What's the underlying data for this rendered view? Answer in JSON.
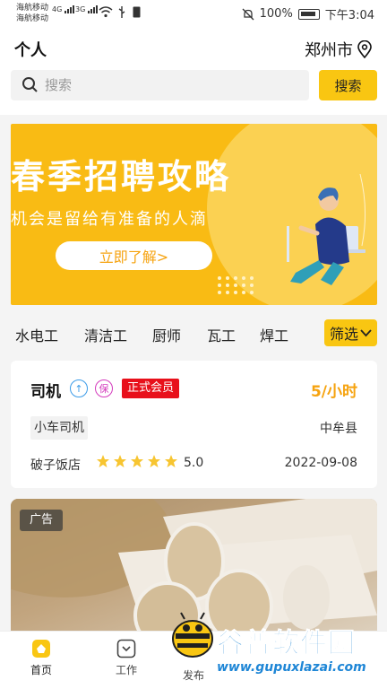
{
  "status_bar": {
    "carrier_1": "海航移动",
    "carrier_2": "海航移动",
    "net_1": "4G",
    "net_2": "3G",
    "battery": "100%",
    "time": "下午3:04"
  },
  "header": {
    "title": "个人",
    "city": "郑州市"
  },
  "search": {
    "placeholder": "搜索",
    "button": "搜索"
  },
  "banner": {
    "title": "春季招聘攻略",
    "subtitle": "机会是留给有准备的人滴",
    "button": "立即了解>"
  },
  "categories": {
    "items": [
      "水电工",
      "清洁工",
      "厨师",
      "瓦工",
      "焊工"
    ],
    "filter": "筛选"
  },
  "job": {
    "title": "司机",
    "badge": "正式会员",
    "salary": "5/小时",
    "tag": "小车司机",
    "location": "中牟县",
    "company": "破子饭店",
    "rating": "5.0",
    "date": "2022-09-08",
    "icons": {
      "arrow_up_icon": "↑",
      "bao_icon": "保"
    }
  },
  "ad": {
    "label": "广告"
  },
  "tabs": {
    "home": "首页",
    "work": "工作",
    "post": "发布"
  },
  "watermark": {
    "text": "谷普软件园",
    "url": "www.gupuxlazai.com"
  },
  "colors": {
    "accent": "#f9c612",
    "salary": "#f6a30f",
    "member_badge": "#e8101b",
    "banner": "#f9bb14"
  }
}
